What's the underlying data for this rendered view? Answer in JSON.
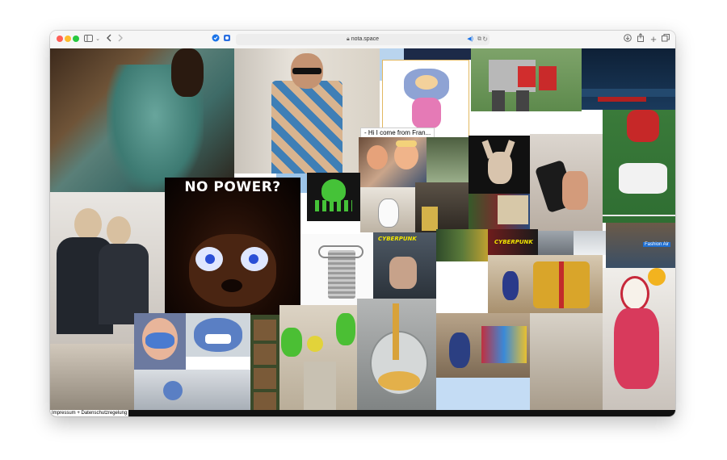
{
  "browser": {
    "url": "nota.space",
    "icons": {
      "back": "chevron-left-icon",
      "forward": "chevron-right-icon",
      "sidebar": "sidebar-icon",
      "lock": "lock-icon",
      "download": "download-icon",
      "share": "share-icon",
      "new_tab": "plus-icon",
      "tabs": "tab-overview-icon"
    }
  },
  "collage": {
    "meme_caption": "NO POWER?",
    "speech_bubble": "- Hi I come from Fran...",
    "game_logo": "CYBERPUNK",
    "game_logo_2": "CYBERPUNK",
    "video_badge": "Fashion Air"
  },
  "footer": {
    "link": "Impressum + Datenschutzregelung"
  }
}
